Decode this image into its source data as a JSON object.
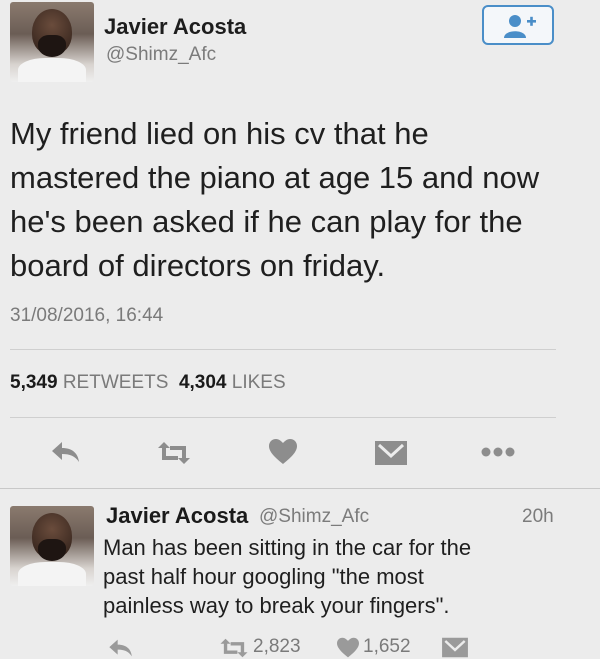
{
  "tweet": {
    "author_name": "Javier Acosta",
    "author_handle": "@Shimz_Afc",
    "text": "My friend lied on his cv that he\nmastered the piano at age 15 and now\nhe's been asked if he can  play for the\nboard of directors on friday.",
    "timestamp": "31/08/2016, 16:44",
    "retweets_count": "5,349",
    "retweets_label": "RETWEETS",
    "likes_count": "4,304",
    "likes_label": "LIKES"
  },
  "reply": {
    "author_name": "Javier Acosta",
    "author_handle": "@Shimz_Afc",
    "time": "20h",
    "text": "Man has been sitting in the car for the\npast half hour googling \"the most\npainless way to break your fingers\".",
    "retweets_count": "2,823",
    "likes_count": "1,652"
  },
  "icons": {
    "follow": "add-user-icon",
    "reply": "reply-icon",
    "retweet": "retweet-icon",
    "like": "heart-icon",
    "message": "envelope-icon",
    "more": "more-icon"
  },
  "colors": {
    "accent": "#4a8ec8",
    "icon_gray": "#8d8d8d",
    "background": "#ececec"
  }
}
